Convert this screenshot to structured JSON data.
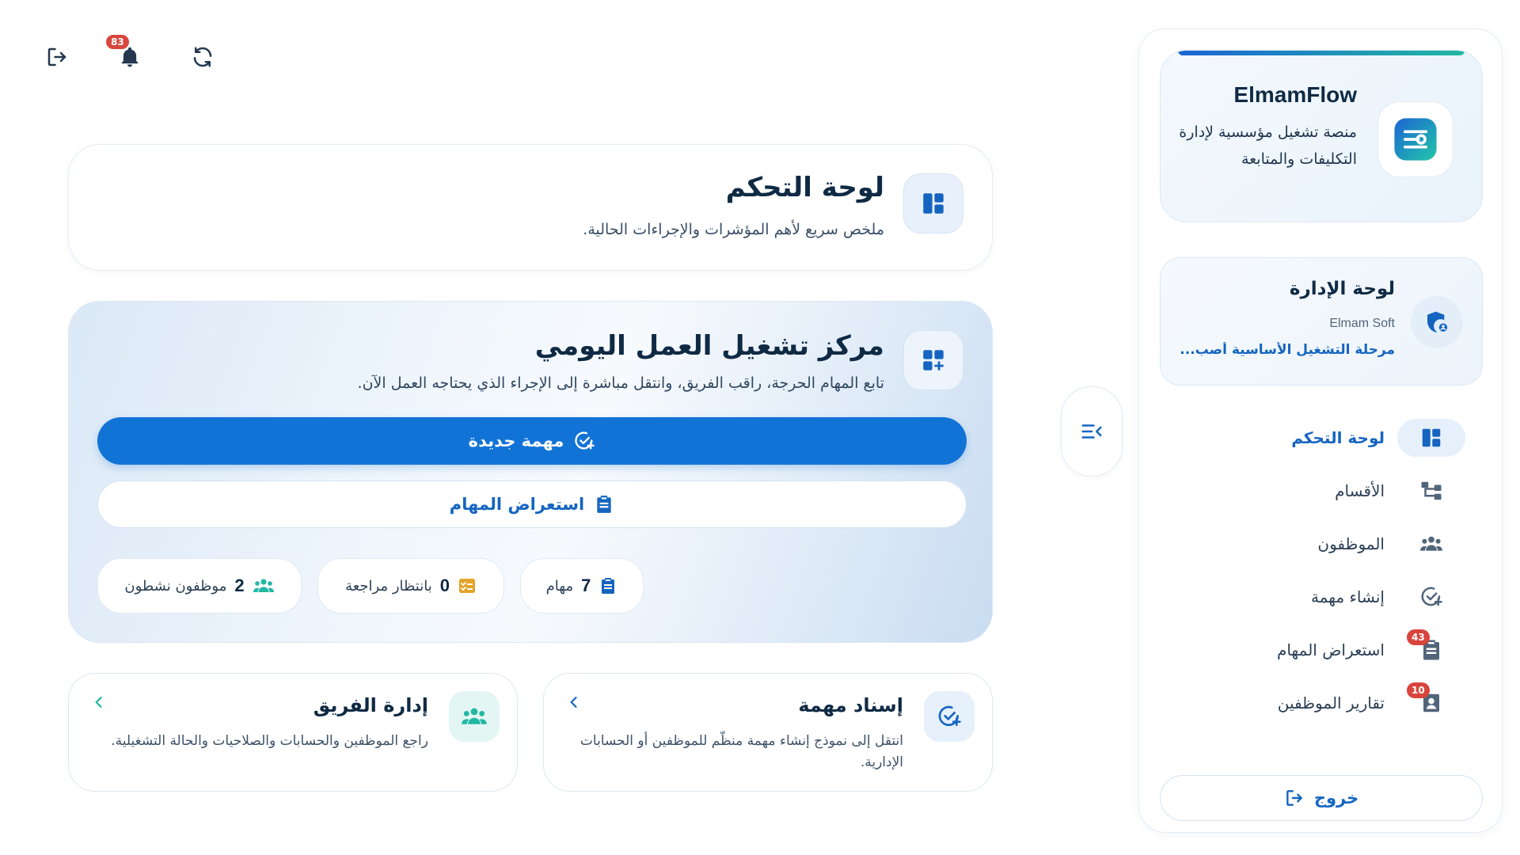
{
  "topbar": {
    "logout_icon": "logout-icon",
    "notifications_count": "83",
    "notifications_icon": "bell-icon",
    "refresh_icon": "refresh-icon"
  },
  "sidebar": {
    "brand": {
      "title": "ElmamFlow",
      "subtitle": "منصة تشغيل مؤسسية لإدارة التكليفات والمتابعة"
    },
    "admin": {
      "title": "لوحة الإدارة",
      "org": "Elmam Soft",
      "phase": "مرحلة التشغيل الأساسية أصب..."
    },
    "items": [
      {
        "label": "لوحة التحكم",
        "icon": "dashboard-icon",
        "active": true
      },
      {
        "label": "الأقسام",
        "icon": "hierarchy-icon"
      },
      {
        "label": "الموظفون",
        "icon": "team-icon"
      },
      {
        "label": "إنشاء مهمة",
        "icon": "add-task-icon"
      },
      {
        "label": "استعراض المهام",
        "icon": "task-list-icon",
        "badge": "43"
      },
      {
        "label": "تقارير الموظفين",
        "icon": "employee-report-icon",
        "badge": "10"
      }
    ],
    "logout_label": "خروج"
  },
  "header": {
    "title": "لوحة التحكم",
    "subtitle": "ملخص سريع لأهم المؤشرات والإجراءات الحالية."
  },
  "hero": {
    "title": "مركز تشغيل العمل اليومي",
    "subtitle": "تابع المهام الحرجة، راقب الفريق، وانتقل مباشرة إلى الإجراء الذي يحتاجه العمل الآن.",
    "primary_label": "مهمة جديدة",
    "secondary_label": "استعراض المهام",
    "stats": [
      {
        "value": "7",
        "label": "مهام",
        "icon": "clipboard-icon"
      },
      {
        "value": "0",
        "label": "بانتظار مراجعة",
        "icon": "review-icon"
      },
      {
        "value": "2",
        "label": "موظفون نشطون",
        "icon": "team-icon"
      }
    ]
  },
  "actions": [
    {
      "title": "إسناد مهمة",
      "desc": "انتقل إلى نموذج إنشاء مهمة منظّم للموظفين أو الحسابات الإدارية."
    },
    {
      "title": "إدارة الفريق",
      "desc": "راجع الموظفين والحسابات والصلاحيات والحالة التشغيلية."
    }
  ],
  "colors": {
    "primary": "#1273d6",
    "accent_teal": "#21b7a3",
    "badge_red": "#d9453c",
    "review_orange": "#e3a42b"
  }
}
